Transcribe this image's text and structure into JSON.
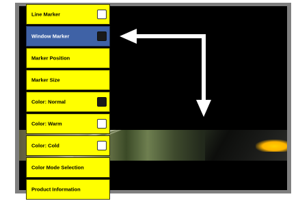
{
  "menu": {
    "items": [
      {
        "label": "Line Marker",
        "checkbox": "empty"
      },
      {
        "label": "Window Marker",
        "checkbox": "filled",
        "selected": true
      },
      {
        "label": "Marker Position",
        "checkbox": "none"
      },
      {
        "label": "Marker Size",
        "checkbox": "none"
      },
      {
        "label": "Color: Normal",
        "checkbox": "filled"
      },
      {
        "label": "Color: Warm",
        "checkbox": "empty"
      },
      {
        "label": "Color: Cold",
        "checkbox": "empty"
      },
      {
        "label": "Color Mode Selection",
        "checkbox": "none"
      },
      {
        "label": "Product Information",
        "checkbox": "none"
      }
    ]
  },
  "colors": {
    "menu_bg": "#ffff00",
    "selected_bg": "#3f62a6",
    "screen_bg": "#000000",
    "frame": "#7f7f7f",
    "arrow": "#ffffff"
  },
  "icons": {
    "arrow": "right-angle-arrow-icon"
  }
}
